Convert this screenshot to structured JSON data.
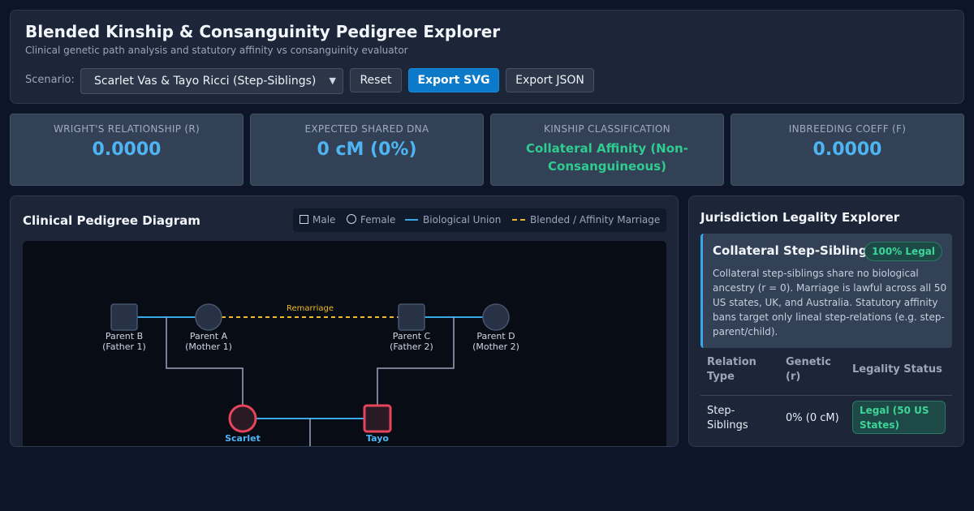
{
  "header": {
    "title": "Blended Kinship & Consanguinity Pedigree Explorer",
    "subtitle": "Clinical genetic path analysis and statutory affinity vs consanguinity evaluator",
    "scenario_label": "Scenario:",
    "scenario_selected": "Scarlet Vas & Tayo Ricci (Step-Siblings)",
    "reset_label": "Reset",
    "export_svg_label": "Export SVG",
    "export_json_label": "Export JSON"
  },
  "stats": [
    {
      "label": "WRIGHT'S RELATIONSHIP (R)",
      "value": "0.0000"
    },
    {
      "label": "EXPECTED SHARED DNA",
      "value": "0 cM (0%)"
    },
    {
      "label": "KINSHIP CLASSIFICATION",
      "value": "Collateral Affinity (Non-Consanguineous)"
    },
    {
      "label": "INBREEDING COEFF (F)",
      "value": "0.0000"
    }
  ],
  "pedigree": {
    "title": "Clinical Pedigree Diagram",
    "legend": {
      "male": "Male",
      "female": "Female",
      "bio_union": "Biological Union",
      "affinity": "Blended / Affinity Marriage"
    },
    "remarriage_label": "Remarriage",
    "nodes": [
      {
        "name": "Parent B",
        "role": "(Father 1)"
      },
      {
        "name": "Parent A",
        "role": "(Mother 1)"
      },
      {
        "name": "Parent C",
        "role": "(Father 2)"
      },
      {
        "name": "Parent D",
        "role": "(Mother 2)"
      },
      {
        "name": "Scarlet"
      },
      {
        "name": "Tayo"
      }
    ],
    "colors": {
      "bio_union": "#38a8e8",
      "affinity": "#f0b92a",
      "highlight": "#e8455c"
    }
  },
  "legality": {
    "title": "Jurisdiction Legality Explorer",
    "card_title": "Collateral Step-Siblings",
    "card_badge": "100% Legal",
    "card_body": "Collateral step-siblings share no biological ancestry (r = 0). Marriage is lawful across all 50 US states, UK, and Australia. Statutory affinity bans target only lineal step-relations (e.g. step-parent/child).",
    "columns": [
      "Relation Type",
      "Genetic (r)",
      "Legality Status"
    ],
    "rows": [
      {
        "relation": "Step-Siblings",
        "genetic": "0% (0 cM)",
        "status": "Legal (50 US States)"
      }
    ]
  }
}
